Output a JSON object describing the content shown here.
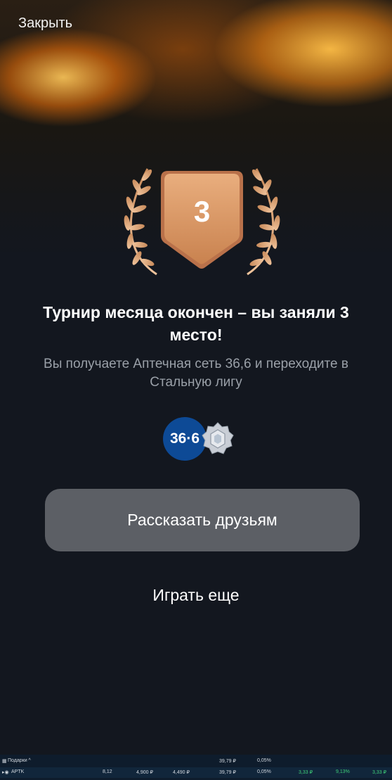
{
  "header": {
    "close_label": "Закрыть"
  },
  "result": {
    "place": "3",
    "title": "Турнир месяца окончен – вы заняли 3 место!",
    "subtitle": "Вы получаете Аптечная сеть 36,6 и переходите в Стальную лигу"
  },
  "prize": {
    "partner_logo_text": "36·6",
    "league_icon": "steel-league-badge-icon"
  },
  "actions": {
    "share_label": "Рассказать друзьям",
    "play_again_label": "Играть еще"
  },
  "taskbar": {
    "row1": {
      "label": "Подарки ^",
      "price": "39,79 ₽",
      "change": "0,05%"
    },
    "row2": {
      "ticker": "APTK",
      "v1": "8,12",
      "v2": "4,900 ₽",
      "v3": "4,490 ₽",
      "v4": "39,79 ₽",
      "v5": "0,05%",
      "v6": "3,33 ₽",
      "v7": "9,13%",
      "v8": "3,33 ₽"
    }
  },
  "colors": {
    "background": "#13171f",
    "badge_bronze": "#d9966a",
    "button_gray": "#5c5f65",
    "partner_blue": "#0d4a96",
    "subtitle_gray": "#9aa0a8"
  }
}
